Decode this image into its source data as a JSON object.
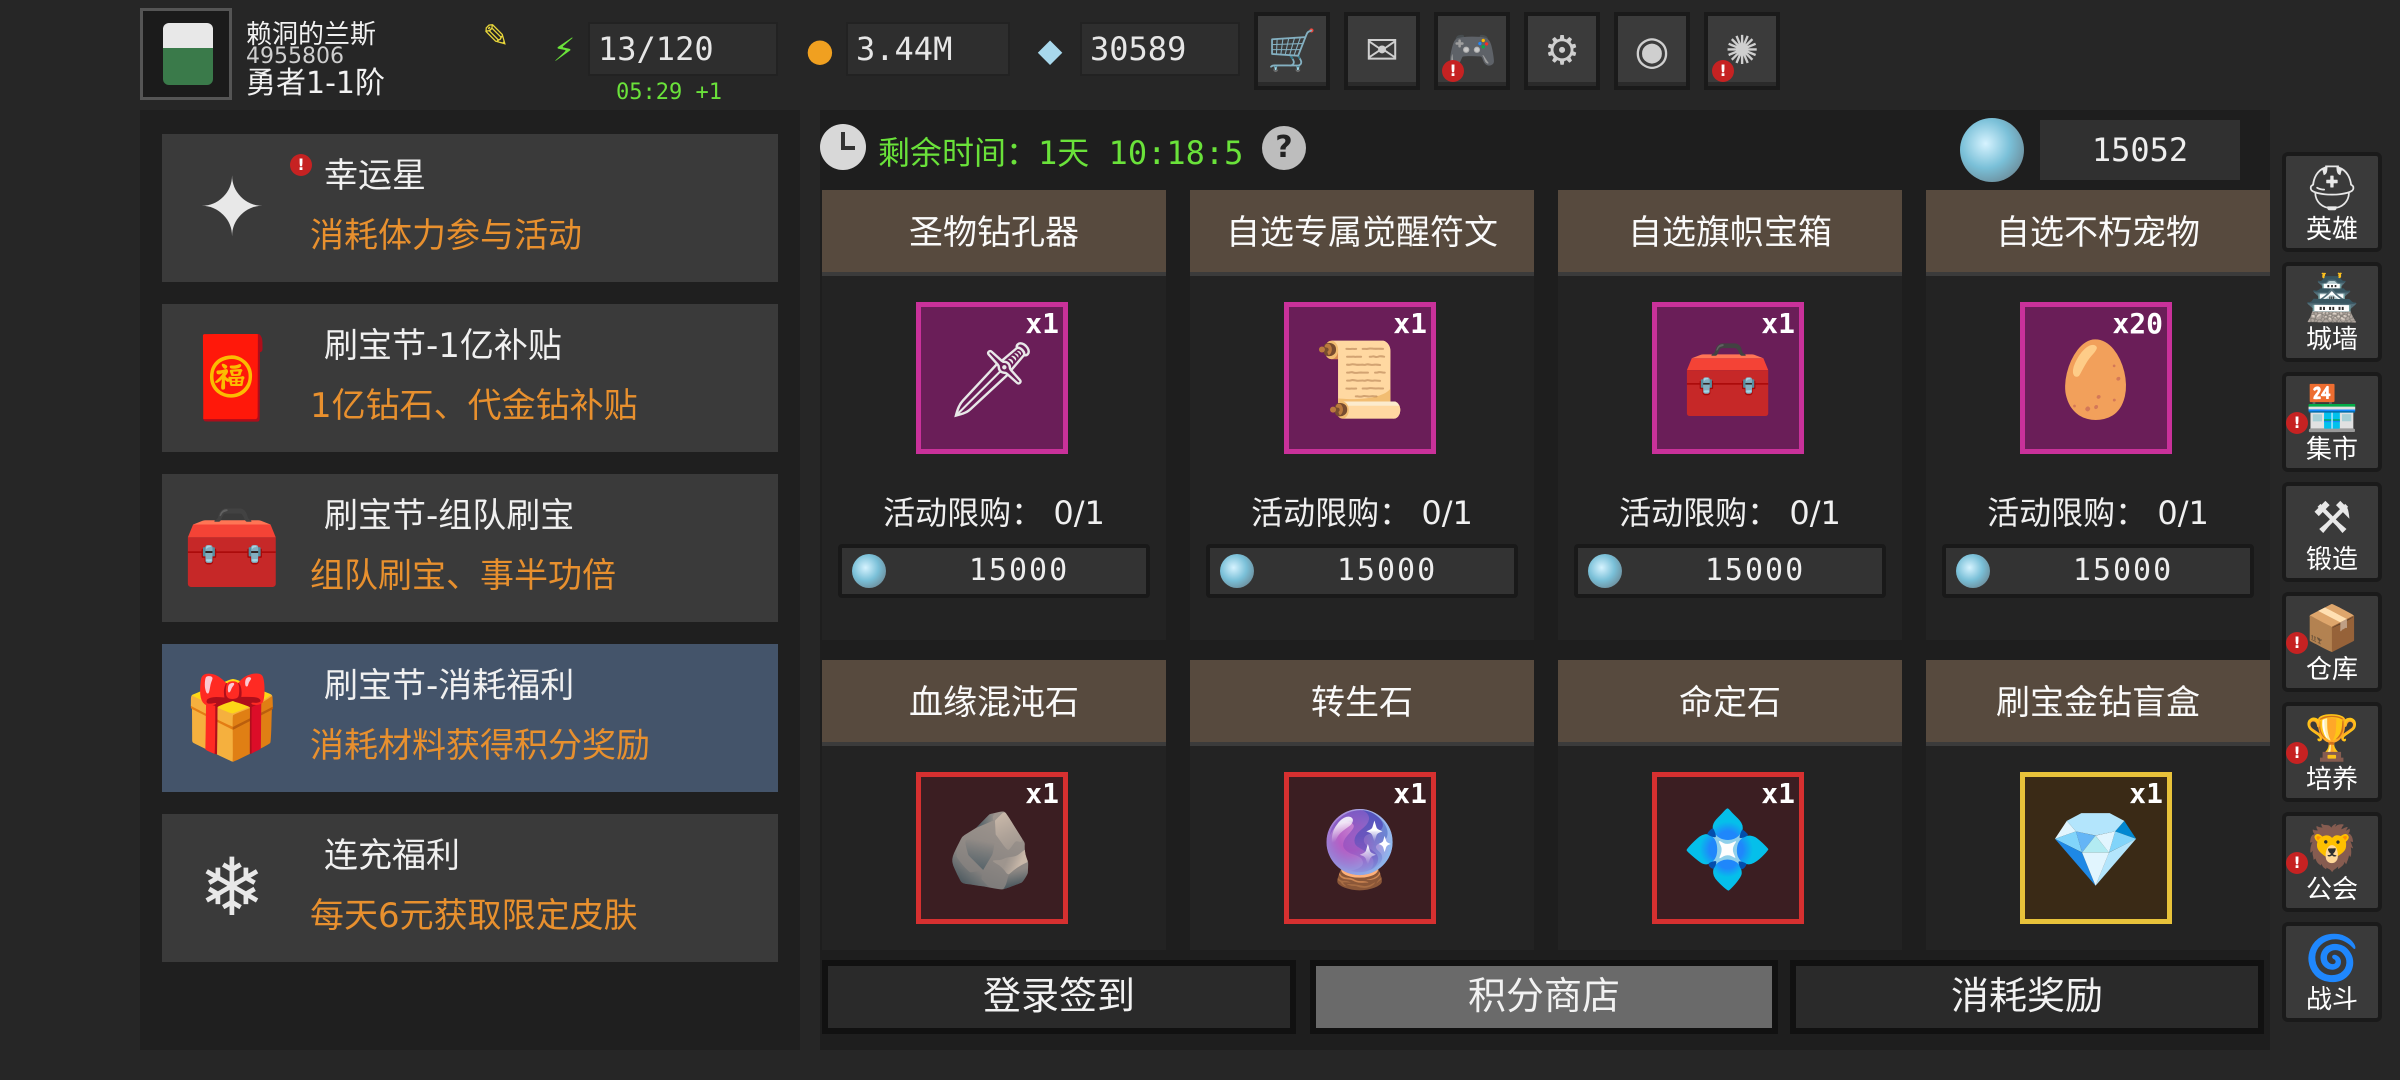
{
  "player": {
    "name": "赖洞的兰斯",
    "id": "4955806",
    "rank": "勇者1-1阶",
    "edit_icon": "edit-icon"
  },
  "resources": {
    "stamina": "13/120",
    "stamina_regen": "05:29 +1",
    "gold": "3.44M",
    "diamonds": "30589"
  },
  "top_buttons": [
    {
      "name": "shop-cart",
      "icon": "cart-icon",
      "glyph": "🛒",
      "alert": false
    },
    {
      "name": "mail",
      "icon": "mail-icon",
      "glyph": "✉",
      "alert": false
    },
    {
      "name": "gamepad",
      "icon": "gamepad-icon",
      "glyph": "🎮",
      "alert": true
    },
    {
      "name": "settings",
      "icon": "gear-icon",
      "glyph": "⚙",
      "alert": false
    },
    {
      "name": "aperture",
      "icon": "aperture-icon",
      "glyph": "◉",
      "alert": false
    },
    {
      "name": "fireworks",
      "icon": "fireworks-icon",
      "glyph": "✺",
      "alert": true
    }
  ],
  "events": [
    {
      "title": "幸运星",
      "subtitle": "消耗体力参与活动",
      "icon": "lucky-star-icon",
      "glyph": "✦",
      "alert": true,
      "active": false
    },
    {
      "title": "刷宝节-1亿补贴",
      "subtitle": "1亿钻石、代金钻补贴",
      "icon": "red-envelope-icon",
      "glyph": "🧧",
      "alert": false,
      "active": false
    },
    {
      "title": "刷宝节-组队刷宝",
      "subtitle": "组队刷宝、事半功倍",
      "icon": "treasure-chest-icon",
      "glyph": "🧰",
      "alert": false,
      "active": false
    },
    {
      "title": "刷宝节-消耗福利",
      "subtitle": "消耗材料获得积分奖励",
      "icon": "open-chest-icon",
      "glyph": "🎁",
      "alert": false,
      "active": true
    },
    {
      "title": "连充福利",
      "subtitle": "每天6元获取限定皮肤",
      "icon": "crystal-icon",
      "glyph": "❄",
      "alert": false,
      "active": false
    }
  ],
  "timer": {
    "label": "剩余时间：",
    "value": "1天 10:18:5"
  },
  "currency": {
    "value": "15052"
  },
  "shop_items": [
    {
      "name": "圣物钻孔器",
      "qty": "x1",
      "limit": "活动限购： 0/1",
      "price": "15000",
      "frame": "purple",
      "icon": "drill-icon",
      "glyph": "🗡"
    },
    {
      "name": "自选专属觉醒符文",
      "qty": "x1",
      "limit": "活动限购： 0/1",
      "price": "15000",
      "frame": "purple",
      "icon": "rune-icon",
      "glyph": "📜"
    },
    {
      "name": "自选旗帜宝箱",
      "qty": "x1",
      "limit": "活动限购： 0/1",
      "price": "15000",
      "frame": "purple",
      "icon": "banner-chest-icon",
      "glyph": "🧰"
    },
    {
      "name": "自选不朽宠物",
      "qty": "x20",
      "limit": "活动限购： 0/1",
      "price": "15000",
      "frame": "purple",
      "icon": "pet-chest-icon",
      "glyph": "🥚"
    },
    {
      "name": "血缘混沌石",
      "qty": "x1",
      "frame": "red",
      "icon": "chaos-stone-icon",
      "glyph": "🪨"
    },
    {
      "name": "转生石",
      "qty": "x1",
      "frame": "red",
      "icon": "rebirth-stone-icon",
      "glyph": "🔮"
    },
    {
      "name": "命定石",
      "qty": "x1",
      "frame": "red",
      "icon": "fate-stone-icon",
      "glyph": "💠"
    },
    {
      "name": "刷宝金钻盲盒",
      "qty": "x1",
      "frame": "gold",
      "icon": "blind-box-icon",
      "glyph": "💎"
    }
  ],
  "tabs": [
    {
      "label": "登录签到",
      "active": false
    },
    {
      "label": "积分商店",
      "active": true
    },
    {
      "label": "消耗奖励",
      "active": false
    }
  ],
  "nav": [
    {
      "label": "英雄",
      "icon": "helmet-icon",
      "glyph": "⛑",
      "alert": false
    },
    {
      "label": "城墙",
      "icon": "wall-icon",
      "glyph": "🏯",
      "alert": false
    },
    {
      "label": "集市",
      "icon": "market-icon",
      "glyph": "🏪",
      "alert": true
    },
    {
      "label": "锻造",
      "icon": "anvil-icon",
      "glyph": "⚒",
      "alert": false
    },
    {
      "label": "仓库",
      "icon": "warehouse-icon",
      "glyph": "📦",
      "alert": true
    },
    {
      "label": "培养",
      "icon": "trophy-icon",
      "glyph": "🏆",
      "alert": true
    },
    {
      "label": "公会",
      "icon": "guild-icon",
      "glyph": "🦁",
      "alert": true
    },
    {
      "label": "战斗",
      "icon": "portal-icon",
      "glyph": "🌀",
      "alert": false
    }
  ]
}
